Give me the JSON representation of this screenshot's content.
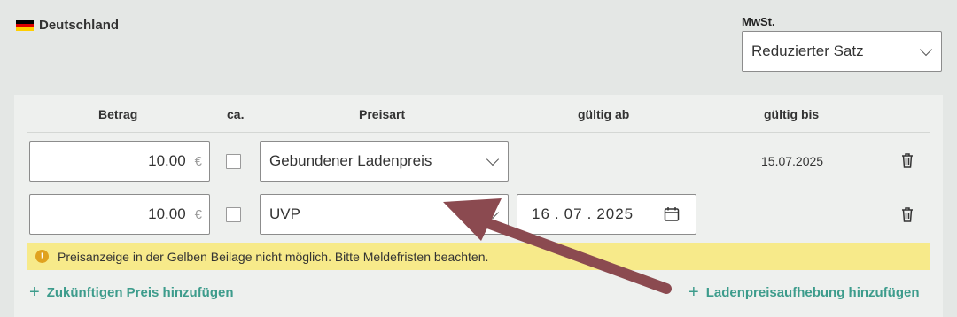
{
  "country": {
    "name": "Deutschland",
    "flag_colors": [
      "#000000",
      "#dd0000",
      "#ffce00"
    ]
  },
  "vat": {
    "label": "MwSt.",
    "selected": "Reduzierter Satz"
  },
  "table": {
    "headers": {
      "amount": "Betrag",
      "approx": "ca.",
      "price_type": "Preisart",
      "valid_from": "gültig ab",
      "valid_to": "gültig bis"
    },
    "rows": [
      {
        "amount": "10.00",
        "currency": "€",
        "price_type": "Gebundener Ladenpreis",
        "valid_to": "15.07.2025"
      },
      {
        "amount": "10.00",
        "currency": "€",
        "price_type": "UVP",
        "valid_from_day": "16",
        "valid_from_month": "07",
        "valid_from_year": "2025"
      }
    ]
  },
  "notice": {
    "icon": "!",
    "text": "Preisanzeige in der Gelben Beilage nicht möglich. Bitte Meldefristen beachten."
  },
  "actions": {
    "add_future_price": "Zukünftigen Preis hinzufügen",
    "add_price_cancellation": "Ladenpreisaufhebung hinzufügen",
    "plus": "+"
  },
  "colors": {
    "accent": "#3d9c8c",
    "notice_bg": "#f7ea8a",
    "arrow": "#8b4a50"
  }
}
